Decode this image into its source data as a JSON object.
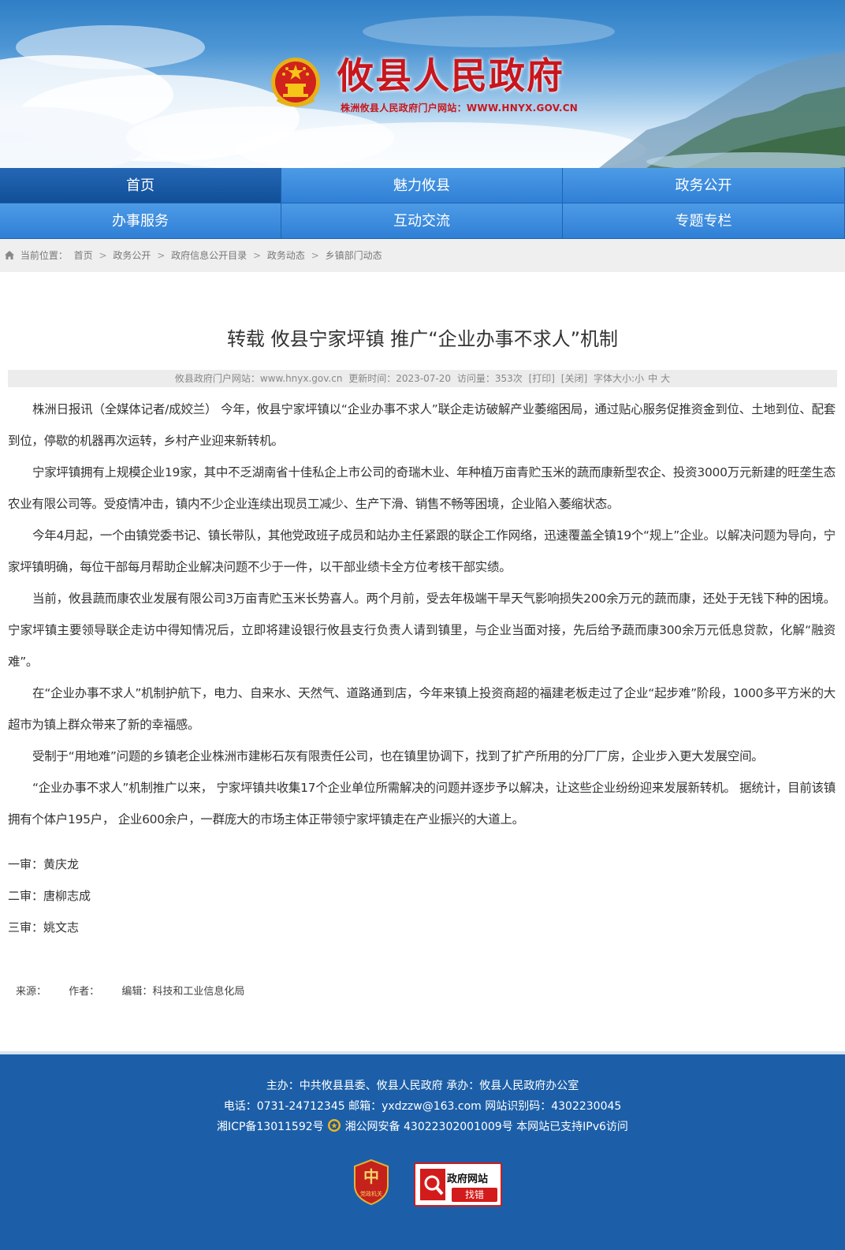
{
  "header": {
    "site_name": "攸县人民政府",
    "site_subtitle": "株洲攸县人民政府门户网站：WWW.HNYX.GOV.CN"
  },
  "nav": {
    "items": [
      {
        "label": "首页",
        "active": true
      },
      {
        "label": "魅力攸县",
        "active": false
      },
      {
        "label": "政务公开",
        "active": false
      },
      {
        "label": "办事服务",
        "active": false
      },
      {
        "label": "互动交流",
        "active": false
      },
      {
        "label": "专题专栏",
        "active": false
      }
    ]
  },
  "breadcrumb": {
    "prefix": "当前位置：",
    "items": [
      "首页",
      "政务公开",
      "政府信息公开目录",
      "政务动态",
      "乡镇部门动态"
    ],
    "separator": ">"
  },
  "article": {
    "title": "转载 攸县宁家坪镇 推广“企业办事不求人”机制",
    "meta": {
      "site": "攸县政府门户网站：www.hnyx.gov.cn",
      "updated": "更新时间：2023-07-20",
      "visits": "访问量：353次",
      "print": "[打印]",
      "close": "[关闭]",
      "font_size_label": "字体大小:",
      "font_small": "小",
      "font_medium": "中",
      "font_large": "大"
    },
    "paragraphs": [
      "株洲日报讯（全媒体记者/成姣兰） 今年，攸县宁家坪镇以“企业办事不求人”联企走访破解产业萎缩困局，通过贴心服务促推资金到位、土地到位、配套到位，停歇的机器再次运转，乡村产业迎来新转机。",
      "宁家坪镇拥有上规模企业19家，其中不乏湖南省十佳私企上市公司的奇瑞木业、年种植万亩青贮玉米的蔬而康新型农企、投资3000万元新建的旺垄生态农业有限公司等。受疫情冲击，镇内不少企业连续出现员工减少、生产下滑、销售不畅等困境，企业陷入萎缩状态。",
      "今年4月起，一个由镇党委书记、镇长带队，其他党政班子成员和站办主任紧跟的联企工作网络，迅速覆盖全镇19个“规上”企业。以解决问题为导向，宁家坪镇明确，每位干部每月帮助企业解决问题不少于一件，以干部业绩卡全方位考核干部实绩。",
      "当前，攸县蔬而康农业发展有限公司3万亩青贮玉米长势喜人。两个月前，受去年极端干旱天气影响损失200余万元的蔬而康，还处于无钱下种的困境。宁家坪镇主要领导联企走访中得知情况后，立即将建设银行攸县支行负责人请到镇里，与企业当面对接，先后给予蔬而康300余万元低息贷款，化解“融资难”。",
      "在“企业办事不求人”机制护航下，电力、自来水、天然气、道路通到店，今年来镇上投资商超的福建老板走过了企业“起步难”阶段，1000多平方米的大超市为镇上群众带来了新的幸福感。",
      "受制于“用地难”问题的乡镇老企业株洲市建彬石灰有限责任公司，也在镇里协调下，找到了扩产所用的分厂厂房，企业步入更大发展空间。",
      "“企业办事不求人”机制推广以来， 宁家坪镇共收集17个企业单位所需解决的问题并逐步予以解决，让这些企业纷纷迎来发展新转机。 据统计，目前该镇拥有个体户195户， 企业600余户，一群庞大的市场主体正带领宁家坪镇走在产业振兴的大道上。"
    ],
    "reviews": [
      "一审：黄庆龙",
      "二审：唐柳志成",
      "三审：姚文志"
    ],
    "source": {
      "source_label": "来源：",
      "author_label": "作者：",
      "editor": "编辑：科技和工业信息化局"
    }
  },
  "footer": {
    "line1": "主办：中共攸县县委、攸县人民政府 承办：攸县人民政府办公室",
    "line2": "电话：0731-24712345  邮箱：yxdzzw@163.com  网站识别码：4302230045",
    "icp": "湘ICP备13011592号",
    "police": "湘公网安备 43022302001009号",
    "ipv6": "本网站已支持IPv6访问",
    "party_badge_text": "党政机关",
    "error_title": "政府网站",
    "error_action": "找错"
  },
  "colors": {
    "brand_red": "#c8161d",
    "nav_blue": "#2f7fd6",
    "nav_active": "#114f98",
    "footer_blue": "#1c5fa8"
  }
}
